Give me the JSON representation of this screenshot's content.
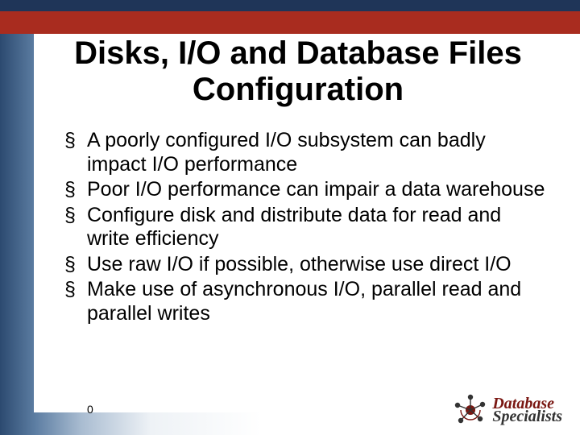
{
  "title": "Disks, I/O and Database Files Configuration",
  "bullets": [
    "A poorly configured I/O subsystem can badly impact I/O performance",
    "Poor I/O performance can impair a data warehouse",
    "Configure disk and distribute data for read and write efficiency",
    "Use raw I/O if possible, otherwise use direct I/O",
    "Make use of asynchronous I/O, parallel read and parallel writes"
  ],
  "page_number": "0",
  "logo": {
    "line1": "Database",
    "line2": "Specialists"
  }
}
